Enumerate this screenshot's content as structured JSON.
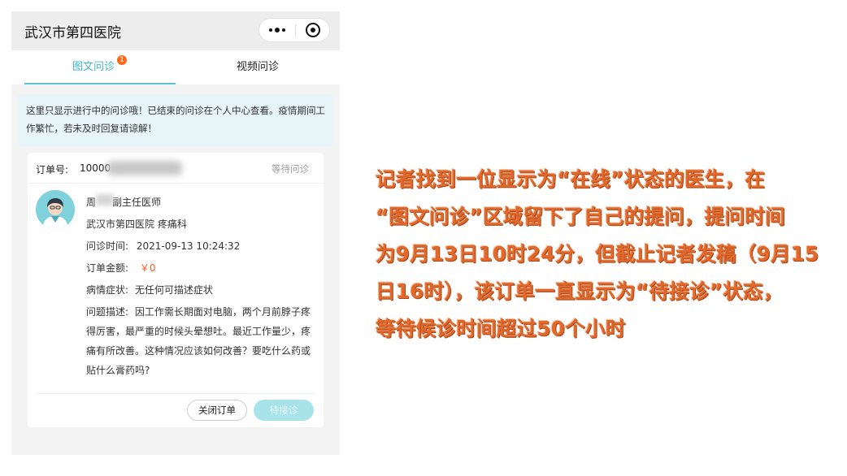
{
  "nav": {
    "title": "武汉市第四医院",
    "more_icon": "more-dots-icon",
    "close_icon": "mini-program-close-icon"
  },
  "tabs": [
    {
      "label": "图文问诊",
      "badge": "1",
      "active": true
    },
    {
      "label": "视频问诊",
      "active": false
    }
  ],
  "notice": {
    "text": "这里只显示进行中的问诊哦！已结束的问诊在个人中心查看。疫情期间工作繁忙，若未及时回复请谅解！"
  },
  "order": {
    "number_label": "订单号:",
    "number_visible": "10000",
    "status": "等待问诊",
    "doctor_name_visible": "周",
    "doctor_title": "副主任医师",
    "hospital_dept": "武汉市第四医院 疼痛科",
    "time_label": "问诊时间:",
    "time_value": "2021-09-13 10:24:32",
    "amount_label": "订单金额:",
    "amount_value": "￥0",
    "symptom_label": "病情症状:",
    "symptom_value": "无任何可描述症状",
    "desc_label": "问题描述:",
    "desc_value": "因工作需长期面对电脑，两个月前脖子疼得厉害，最严重的时候头晕想吐。最近工作量少，疼痛有所改善。这种情况应该如何改善？要吃什么药或贴什么膏药吗?",
    "close_button": "关闭订单",
    "wait_button": "待接诊"
  },
  "caption": {
    "lines": [
      "记者找到一位显示为“在线”状态的医生，在",
      "“图文问诊”区域留下了自己的提问，提问时间",
      "为9月13日10时24分，但截止记者发稿（9月15",
      "日16时），该订单一直显示为“待接诊”状态，",
      "等待候诊时间超过50个小时"
    ]
  },
  "colors": {
    "accent": "#3fb6c8",
    "badge": "#ff6a1a",
    "price": "#ff5a1f",
    "caption": "#e2692b",
    "notice_bg": "#e7f4f8"
  }
}
